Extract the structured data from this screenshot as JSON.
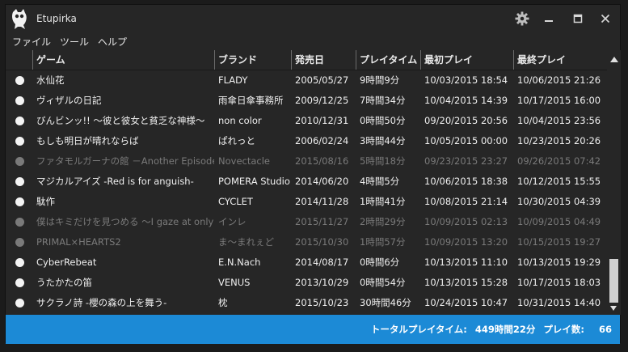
{
  "window": {
    "title": "Etupirka"
  },
  "menu": [
    "ファイル",
    "ツール",
    "ヘルプ"
  ],
  "columns": [
    "ゲーム",
    "ブランド",
    "発売日",
    "プレイタイム",
    "最初プレイ",
    "最終プレイ"
  ],
  "rows": [
    {
      "game": "水仙花",
      "brand": "FLADY",
      "release": "2005/05/27",
      "playtime": "9時間9分",
      "first": "10/03/2015 18:54",
      "last": "10/06/2015 21:26",
      "active": true
    },
    {
      "game": "ヴィザルの日記",
      "brand": "雨傘日傘事務所",
      "release": "2009/12/25",
      "playtime": "7時間34分",
      "first": "10/04/2015 14:39",
      "last": "10/17/2015 16:00",
      "active": true
    },
    {
      "game": "びんビンッ!! ～彼と彼女と貧乏な神様～",
      "brand": "non color",
      "release": "2010/12/31",
      "playtime": "0時間50分",
      "first": "09/20/2015 20:56",
      "last": "10/04/2015 23:56",
      "active": true
    },
    {
      "game": "もしも明日が晴れならば",
      "brand": "ぱれっと",
      "release": "2006/02/24",
      "playtime": "3時間44分",
      "first": "10/05/2015 00:00",
      "last": "10/23/2015 20:26",
      "active": true
    },
    {
      "game": "ファタモルガーナの館 －Another Episode",
      "brand": "Novectacle",
      "release": "2015/08/16",
      "playtime": "5時間18分",
      "first": "09/23/2015 23:27",
      "last": "09/26/2015 07:42",
      "active": false
    },
    {
      "game": "マジカルアイズ -Red is for anguish-",
      "brand": "POMERA Studio",
      "release": "2014/06/20",
      "playtime": "4時間5分",
      "first": "10/06/2015 18:38",
      "last": "10/12/2015 15:55",
      "active": true
    },
    {
      "game": "駄作",
      "brand": "CYCLET",
      "release": "2014/11/28",
      "playtime": "1時間41分",
      "first": "10/08/2015 21:14",
      "last": "10/30/2015 04:39",
      "active": true
    },
    {
      "game": "僕はキミだけを見つめる ～I gaze at only",
      "brand": "インレ",
      "release": "2015/11/27",
      "playtime": "2時間29分",
      "first": "10/09/2015 02:13",
      "last": "10/09/2015 04:49",
      "active": false
    },
    {
      "game": "PRIMAL×HEARTS2",
      "brand": "ま～まれぇど",
      "release": "2015/10/30",
      "playtime": "1時間57分",
      "first": "10/09/2015 13:20",
      "last": "10/15/2015 19:27",
      "active": false
    },
    {
      "game": "CyberRebeat",
      "brand": "E.N.Nach",
      "release": "2014/08/17",
      "playtime": "0時間6分",
      "first": "10/13/2015 11:10",
      "last": "10/13/2015 19:29",
      "active": true
    },
    {
      "game": "うたかたの笛",
      "brand": "VENUS",
      "release": "2013/10/29",
      "playtime": "0時間54分",
      "first": "10/13/2015 15:28",
      "last": "10/17/2015 18:03",
      "active": true
    },
    {
      "game": "サクラノ詩 -櫻の森の上を舞う-",
      "brand": "枕",
      "release": "2015/10/23",
      "playtime": "30時間46分",
      "first": "10/24/2015 10:47",
      "last": "10/31/2015 14:40",
      "active": true
    }
  ],
  "status": {
    "total_label": "トータルプレイタイム:",
    "total_value": "449時間22分",
    "count_label": "プレイ数:",
    "count_value": "66"
  },
  "colors": {
    "accent": "#1c8ad6",
    "background": "#262626",
    "inactive_text": "#7a7a7a"
  }
}
